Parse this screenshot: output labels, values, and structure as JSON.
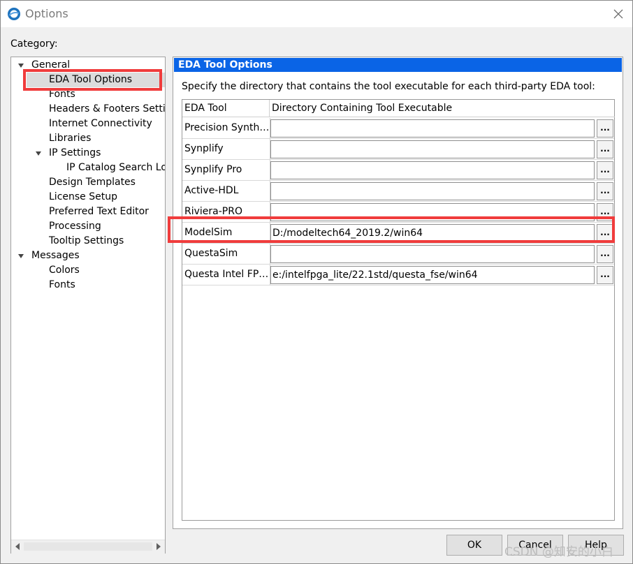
{
  "window": {
    "title": "Options"
  },
  "category_label": "Category:",
  "tree": {
    "items": [
      {
        "label": "General",
        "level": 0,
        "expanded": true
      },
      {
        "label": "EDA Tool Options",
        "level": 1,
        "selected": true
      },
      {
        "label": "Fonts",
        "level": 1
      },
      {
        "label": "Headers & Footers Settings",
        "level": 1
      },
      {
        "label": "Internet Connectivity",
        "level": 1
      },
      {
        "label": "Libraries",
        "level": 1
      },
      {
        "label": "IP Settings",
        "level": 1,
        "expanded": true
      },
      {
        "label": "IP Catalog Search Locations",
        "level": 2
      },
      {
        "label": "Design Templates",
        "level": 1
      },
      {
        "label": "License Setup",
        "level": 1
      },
      {
        "label": "Preferred Text Editor",
        "level": 1
      },
      {
        "label": "Processing",
        "level": 1
      },
      {
        "label": "Tooltip Settings",
        "level": 1
      },
      {
        "label": "Messages",
        "level": 0,
        "expanded": true
      },
      {
        "label": "Colors",
        "level": 1
      },
      {
        "label": "Fonts",
        "level": 1
      }
    ]
  },
  "panel": {
    "header": "EDA Tool Options",
    "instruction": "Specify the directory that contains the tool executable for each third-party EDA tool:",
    "columns": [
      "EDA Tool",
      "Directory Containing Tool Executable"
    ],
    "rows": [
      {
        "tool": "Precision Synthesis",
        "tool_display": "Precision Synth…",
        "path": ""
      },
      {
        "tool": "Synplify",
        "tool_display": "Synplify",
        "path": ""
      },
      {
        "tool": "Synplify Pro",
        "tool_display": "Synplify Pro",
        "path": ""
      },
      {
        "tool": "Active-HDL",
        "tool_display": "Active-HDL",
        "path": ""
      },
      {
        "tool": "Riviera-PRO",
        "tool_display": "Riviera-PRO",
        "path": ""
      },
      {
        "tool": "ModelSim",
        "tool_display": "ModelSim",
        "path": "D:/modeltech64_2019.2/win64"
      },
      {
        "tool": "QuestaSim",
        "tool_display": "QuestaSim",
        "path": ""
      },
      {
        "tool": "Questa Intel FPGA",
        "tool_display": "Questa Intel FP…",
        "path": "e:/intelfpga_lite/22.1std/questa_fse/win64"
      }
    ],
    "browse_label": "..."
  },
  "buttons": {
    "ok": "OK",
    "cancel": "Cancel",
    "help": "Help"
  },
  "watermark": "CSDN @知安的小白",
  "colors": {
    "header_bg": "#0a64e6",
    "annotation": "#f03c3c",
    "selection": "#dcdcdc"
  },
  "icons": {
    "app": "quartus-globe-icon",
    "close": "close-icon"
  }
}
